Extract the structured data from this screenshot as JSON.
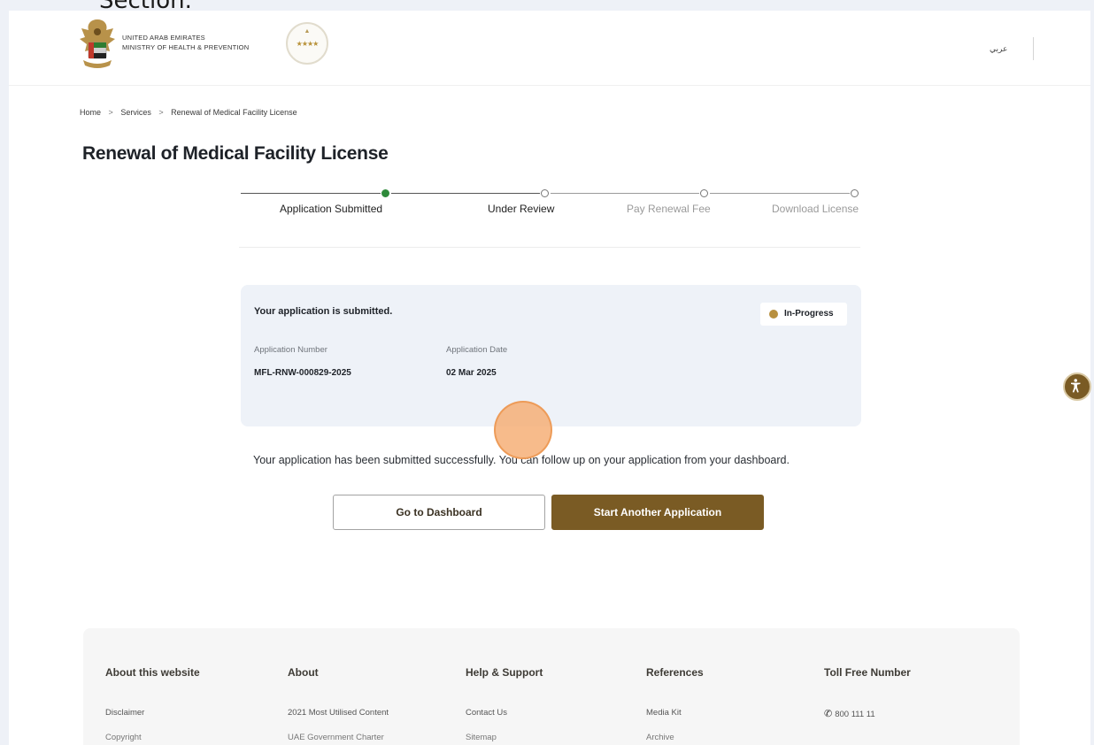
{
  "caption": "Section.",
  "header": {
    "ministry_line1": "UNITED ARAB EMIRATES",
    "ministry_line2": "MINISTRY OF HEALTH & PREVENTION",
    "rating_stars": "★★★★",
    "language_link": "عربي"
  },
  "breadcrumb": {
    "items": [
      "Home",
      "Services",
      "Renewal of Medical Facility License"
    ],
    "separator": ">"
  },
  "page_title": "Renewal of Medical Facility License",
  "stepper": {
    "steps": [
      {
        "label": "Application Submitted",
        "state": "done"
      },
      {
        "label": "Under Review",
        "state": "current"
      },
      {
        "label": "Pay Renewal Fee",
        "state": "pending"
      },
      {
        "label": "Download License",
        "state": "pending"
      }
    ]
  },
  "application_card": {
    "heading": "Your application is submitted.",
    "status": "In-Progress",
    "status_color": "#b8903f",
    "number_label": "Application Number",
    "number_value": "MFL-RNW-000829-2025",
    "date_label": "Application Date",
    "date_value": "02 Mar 2025"
  },
  "success_message": "Your application has been submitted successfully. You can follow up on your application from your dashboard.",
  "buttons": {
    "dashboard": "Go to Dashboard",
    "another": "Start Another Application"
  },
  "colors": {
    "primary_brown": "#7a5b24",
    "done_green": "#2e8a3a"
  },
  "footer": {
    "columns": [
      {
        "heading": "About this website",
        "links": [
          "Disclaimer",
          "Copyright"
        ]
      },
      {
        "heading": "About",
        "links": [
          "2021 Most Utilised Content",
          "UAE Government Charter"
        ]
      },
      {
        "heading": "Help & Support",
        "links": [
          "Contact Us",
          "Sitemap"
        ]
      },
      {
        "heading": "References",
        "links": [
          "Media Kit",
          "Archive"
        ]
      },
      {
        "heading": "Toll Free Number",
        "links": [
          "800 111 11"
        ]
      }
    ]
  }
}
